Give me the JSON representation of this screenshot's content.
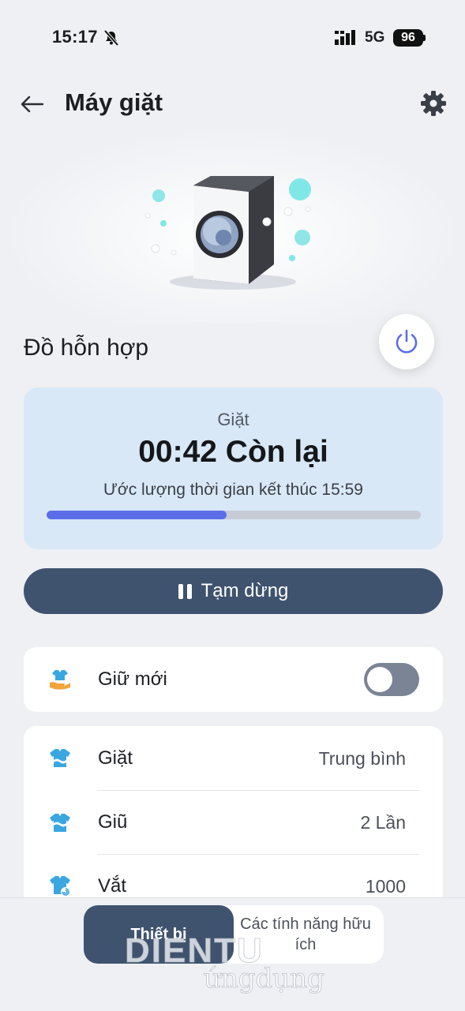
{
  "status_bar": {
    "time": "15:17",
    "network": "5G",
    "battery": "96"
  },
  "header": {
    "title": "Máy giặt"
  },
  "program": {
    "name": "Đồ hỗn hợp"
  },
  "cycle": {
    "phase": "Giặt",
    "remaining": "00:42 Còn lại",
    "estimate": "Ước lượng thời gian kết thúc 15:59",
    "progress": 0.48,
    "colors": {
      "fill": "#5b6ee8",
      "track": "#c7cbd6"
    }
  },
  "pause_button": {
    "label": "Tạm dừng"
  },
  "keep_fresh": {
    "label": "Giữ mới",
    "enabled": false
  },
  "settings": [
    {
      "label": "Giặt",
      "value": "Trung bình",
      "icon": "wash-shirt-icon"
    },
    {
      "label": "Giũ",
      "value": "2 Lần",
      "icon": "rinse-shirt-icon"
    },
    {
      "label": "Vắt",
      "value": "1000",
      "icon": "spin-shirt-icon"
    }
  ],
  "bottom_nav": {
    "active": "Thiết bị",
    "other": "Các tính năng hữu ích"
  },
  "watermark": {
    "line1": "DIENTU",
    "line2": "ứngdụng"
  },
  "colors": {
    "accent": "#3f536f",
    "card_bg": "#d8e8f6",
    "page_bg": "#eef0f4"
  }
}
